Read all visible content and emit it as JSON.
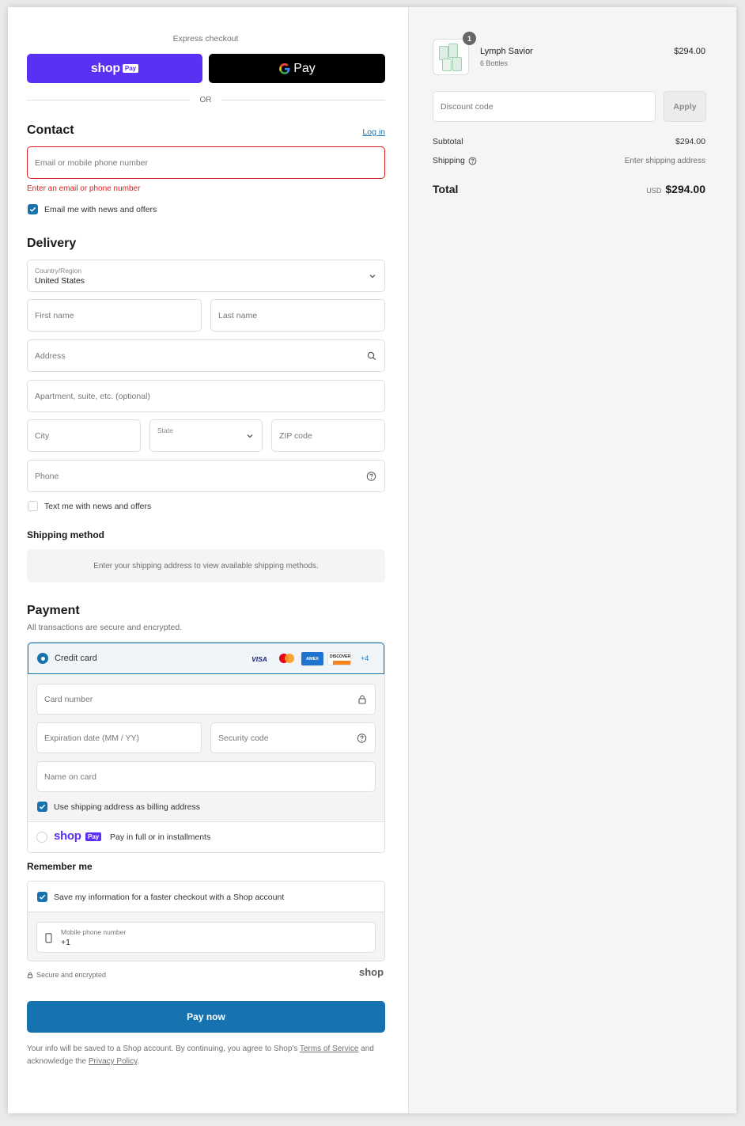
{
  "express": {
    "title": "Express checkout",
    "shop_pay_logo": "shop",
    "shop_pay_badge": "Pay",
    "gpay_label": "Pay",
    "or": "OR"
  },
  "contact": {
    "heading": "Contact",
    "login": "Log in",
    "email_placeholder": "Email or mobile phone number",
    "error": "Enter an email or phone number",
    "news_label": "Email me with news and offers"
  },
  "delivery": {
    "heading": "Delivery",
    "country_label": "Country/Region",
    "country_value": "United States",
    "first_name": "First name",
    "last_name": "Last name",
    "address": "Address",
    "apartment": "Apartment, suite, etc. (optional)",
    "city": "City",
    "state": "State",
    "zip": "ZIP code",
    "phone": "Phone",
    "text_label": "Text me with news and offers"
  },
  "shipping_method": {
    "heading": "Shipping method",
    "message": "Enter your shipping address to view available shipping methods."
  },
  "payment": {
    "heading": "Payment",
    "subtitle": "All transactions are secure and encrypted.",
    "credit_card": "Credit card",
    "brands": [
      "VISA",
      "MC",
      "AMEX",
      "DISCOVER"
    ],
    "more": "+4",
    "card_number": "Card number",
    "expiration": "Expiration date (MM / YY)",
    "security": "Security code",
    "name_on_card": "Name on card",
    "billing_label": "Use shipping address as billing address",
    "shoppay_logo": "shop",
    "shoppay_badge": "Pay",
    "shoppay_label": "Pay in full or in installments"
  },
  "remember": {
    "heading": "Remember me",
    "save_label": "Save my information for a faster checkout with a Shop account",
    "mobile_label": "Mobile phone number",
    "mobile_value": "+1",
    "secure": "Secure and encrypted",
    "shop_logo": "shop"
  },
  "pay_now": "Pay now",
  "legal": {
    "part1": "Your info will be saved to a Shop account. By continuing, you agree to Shop's ",
    "terms": "Terms of Service",
    "part2": " and acknowledge the ",
    "privacy": "Privacy Policy",
    "part3": "."
  },
  "summary": {
    "badge": "1",
    "product_name": "Lymph Savior",
    "product_variant": "6 Bottles",
    "product_price": "$294.00",
    "discount_placeholder": "Discount code",
    "apply": "Apply",
    "subtotal_label": "Subtotal",
    "subtotal_value": "$294.00",
    "shipping_label": "Shipping",
    "shipping_value": "Enter shipping address",
    "total_label": "Total",
    "currency": "USD",
    "total_value": "$294.00"
  },
  "colors": {
    "shop_pay": "#5a31f4",
    "accent": "#1773b0",
    "error": "#dd1d1d"
  }
}
